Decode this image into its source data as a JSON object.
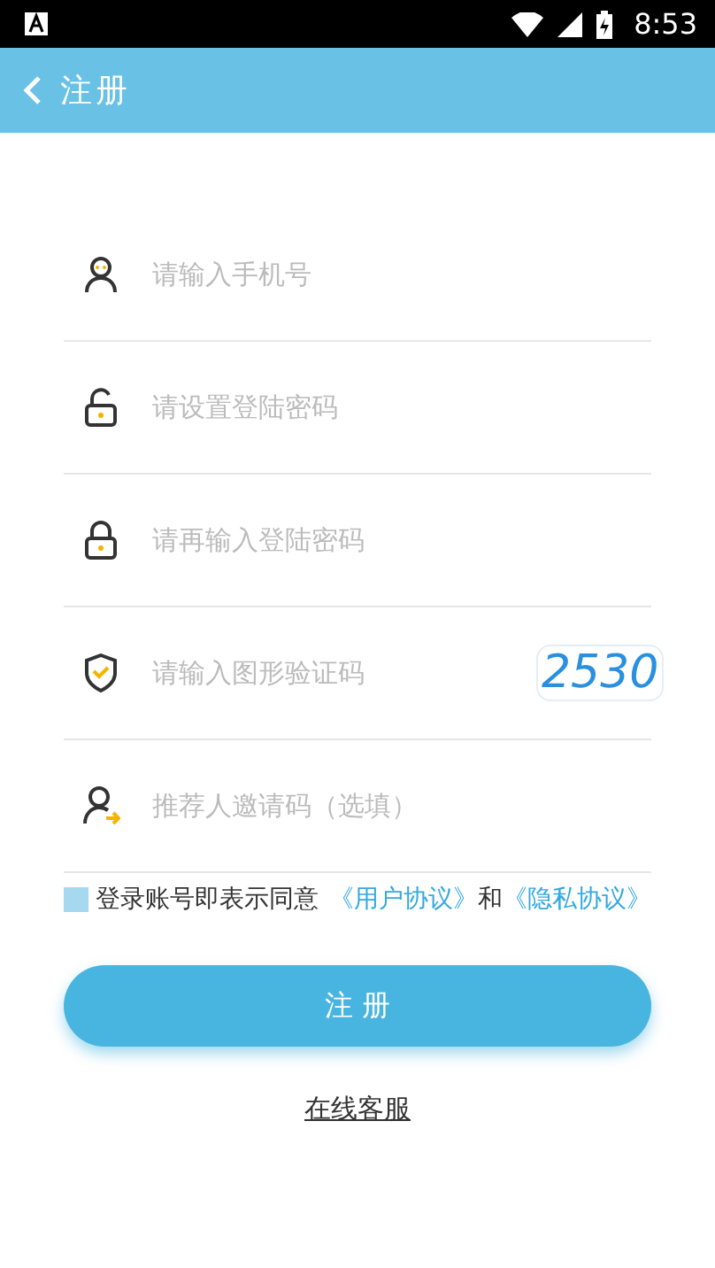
{
  "status_bar": {
    "time": "8:53"
  },
  "app_bar": {
    "title": "注册"
  },
  "fields": [
    {
      "placeholder": "请输入手机号"
    },
    {
      "placeholder": "请设置登陆密码"
    },
    {
      "placeholder": "请再输入登陆密码"
    },
    {
      "placeholder": "请输入图形验证码",
      "captcha": "2530"
    },
    {
      "placeholder": "推荐人邀请码（选填）"
    }
  ],
  "agreement": {
    "checked": false,
    "text": "登录账号即表示同意",
    "links": [
      "《用户协议》",
      "《隐私协议》"
    ],
    "joiner": "和"
  },
  "submit": "注 册",
  "support_link": "在线客服"
}
